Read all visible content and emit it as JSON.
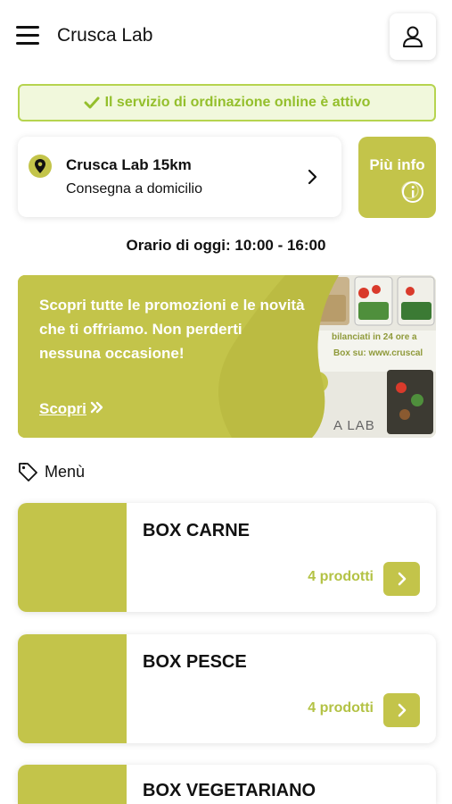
{
  "header": {
    "title": "Crusca Lab",
    "menu_icon": "hamburger-icon",
    "user_icon": "user-icon"
  },
  "status": {
    "text": "Il servizio di ordinazione online è attivo",
    "icon": "check-icon",
    "color": "#94bf2c"
  },
  "store": {
    "name": "Crusca Lab 15km",
    "mode": "Consegna a domicilio",
    "icon": "location-pin-icon"
  },
  "info_button": {
    "label": "Più info",
    "icon": "info-icon"
  },
  "hours": {
    "text": "Orario di oggi: 10:00 - 16:00"
  },
  "promo": {
    "text": "Scopri tutte le promozioni e le novità che ti offriamo. Non perderti nessuna occasione!",
    "cta": "Scopri",
    "photo_caption_1": "bilanciati in 24 ore a",
    "photo_caption_2": "Box su: www.cruscal",
    "photo_brand": "A LAB"
  },
  "menu": {
    "heading": "Menù",
    "icon": "tag-icon",
    "categories": [
      {
        "title": "BOX CARNE",
        "count": "4 prodotti"
      },
      {
        "title": "BOX PESCE",
        "count": "4 prodotti"
      },
      {
        "title": "BOX VEGETARIANO",
        "count": ""
      }
    ]
  },
  "colors": {
    "accent": "#c3c44a",
    "accent_text": "#b3c244",
    "banner_bg": "#f1f8dc"
  }
}
